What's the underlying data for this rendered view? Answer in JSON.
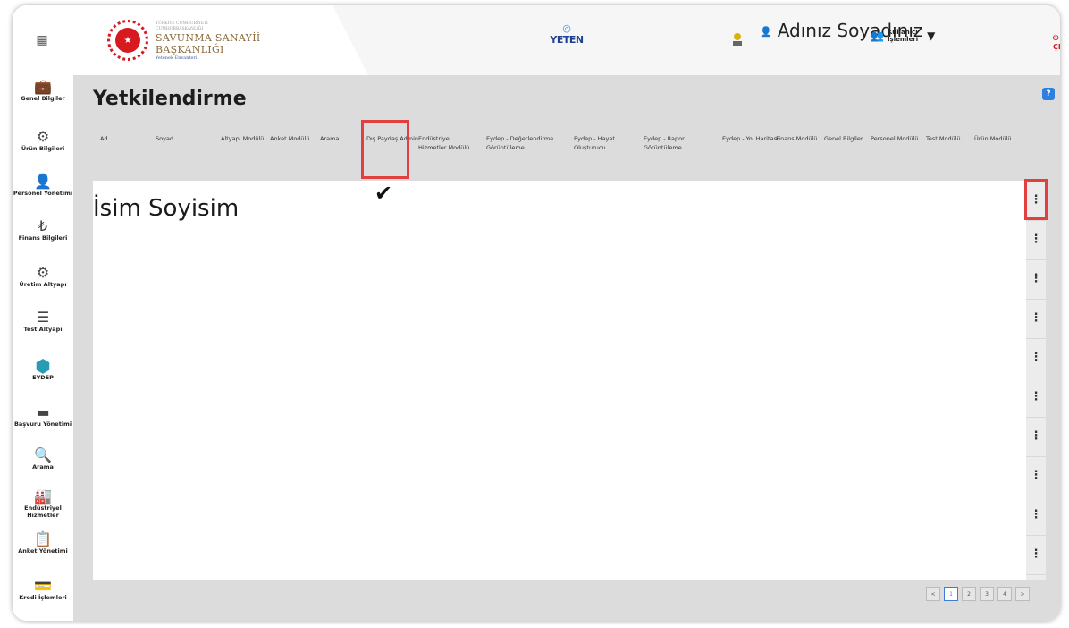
{
  "left_nav": [
    {
      "label": "Genel Bilgiler",
      "icon": "briefcase-icon",
      "glyph": "💼"
    },
    {
      "label": "Ürün Bilgileri",
      "icon": "product-icon",
      "glyph": "⚙"
    },
    {
      "label": "Personel Yönetimi",
      "icon": "personnel-icon",
      "glyph": "👤"
    },
    {
      "label": "Finans Bilgileri",
      "icon": "finance-icon",
      "glyph": "₺"
    },
    {
      "label": "Üretim Altyapı",
      "icon": "production-icon",
      "glyph": "⚙"
    },
    {
      "label": "Test Altyapı",
      "icon": "list-icon",
      "glyph": "☰"
    },
    {
      "label": "EYDEP",
      "icon": "cube-icon",
      "glyph": "⬢"
    },
    {
      "label": "Başvuru Yönetimi",
      "icon": "application-icon",
      "glyph": "▬"
    },
    {
      "label": "Arama",
      "icon": "search-icon",
      "glyph": "🔍"
    },
    {
      "label": "Endüstriyel Hizmetler",
      "icon": "factory-icon",
      "glyph": "🏭"
    },
    {
      "label": "Anket Yönetimi",
      "icon": "survey-icon",
      "glyph": "📋"
    },
    {
      "label": "Kredi İşlemleri",
      "icon": "card-icon",
      "glyph": "💳"
    }
  ],
  "header": {
    "org_line1": "TÜRKİYE CUMHURİYETİ",
    "org_line2": "CUMHURBAŞKANLIĞI",
    "org_name1": "SAVUNMA SANAYİİ",
    "org_name2": "BAŞKANLIĞI",
    "org_sub": "Yetenek Envanteri",
    "app_logo": "YETEN",
    "user_name": "Adınız Soyadınız",
    "user_ops_1": "Kullanıcı",
    "user_ops_2": "İşlemleri",
    "exit_label": "ÇIKIŞ"
  },
  "page": {
    "title": "Yetkilendirme",
    "help": "?"
  },
  "columns": [
    "Ad",
    "Soyad",
    "Altyapı Modülü",
    "Anket Modülü",
    "Arama",
    "Dış Paydaş Admin",
    "Endüstriyel Hizmetler Modülü",
    "Eydep - Değerlendirme Görüntüleme",
    "Eydep - Hayat Oluşturucu",
    "Eydep - Rapor Görüntüleme",
    "Eydep - Yol Haritası",
    "Finans Modülü",
    "Genel Bilgiler",
    "Personel Modülü",
    "Test Modülü",
    "Ürün Modülü"
  ],
  "row": {
    "name": "İsim Soyisim",
    "check": "✔"
  },
  "pagination": [
    "<",
    "1",
    "2",
    "3",
    "4",
    ">"
  ],
  "pagination_active": "1"
}
